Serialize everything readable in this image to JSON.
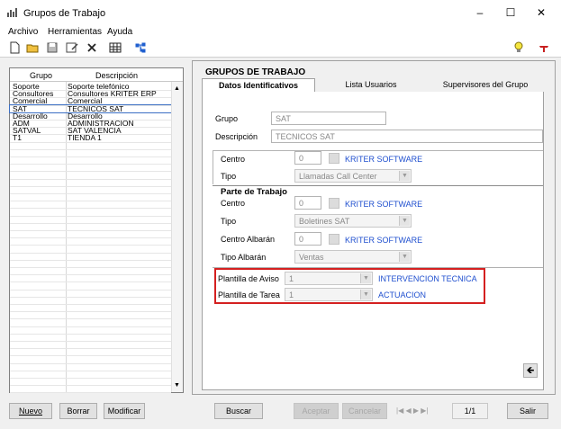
{
  "window": {
    "title": "Grupos de Trabajo",
    "minimize": "–",
    "maximize": "☐",
    "close": "✕"
  },
  "menu": [
    "Archivo",
    "Herramientas",
    "Ayuda"
  ],
  "toolbar": {
    "icons": [
      "new-icon",
      "open-icon",
      "save-icon",
      "edit-icon",
      "delete-icon",
      "grid-icon",
      "tree-icon",
      "lightbulb-icon",
      "exit-icon"
    ]
  },
  "list": {
    "headers": [
      "Grupo",
      "Descripción"
    ],
    "rows": [
      [
        "Soporte",
        "Soporte telefónico"
      ],
      [
        "Consultores",
        "Consultores KRITER ERP"
      ],
      [
        "Comercial",
        "Comercial"
      ],
      [
        "SAT",
        "TECNICOS SAT"
      ],
      [
        "Desarrollo",
        "Desarrollo"
      ],
      [
        "ADM",
        "ADMINISTRACION"
      ],
      [
        "SATVAL",
        "SAT VALENCIA"
      ],
      [
        "T1",
        "TIENDA 1"
      ]
    ],
    "selected_index": 3
  },
  "panel": {
    "title": "GRUPOS DE TRABAJO",
    "tabs": [
      "Datos Identificativos",
      "Lista Usuarios",
      "Supervisores del Grupo"
    ],
    "grupo_label": "Grupo",
    "grupo_value": "SAT",
    "descripcion_label": "Descripción",
    "descripcion_value": "TECNICOS SAT",
    "centro_label": "Centro",
    "centro_value": "0",
    "centro_name": "KRITER SOFTWARE",
    "tipo_label": "Tipo",
    "tipo_value": "Llamadas Call Center",
    "parte_title": "Parte de Trabajo",
    "parte_centro_label": "Centro",
    "parte_centro_value": "0",
    "parte_centro_name": "KRITER SOFTWARE",
    "parte_tipo_label": "Tipo",
    "parte_tipo_value": "Boletines SAT",
    "albaran_centro_label": "Centro Albarán",
    "albaran_centro_value": "0",
    "albaran_centro_name": "KRITER SOFTWARE",
    "albaran_tipo_label": "Tipo Albarán",
    "albaran_tipo_value": "Ventas",
    "plantilla_aviso_label": "Plantilla de Aviso",
    "plantilla_aviso_value": "1",
    "plantilla_aviso_name": "INTERVENCION TECNICA",
    "plantilla_tarea_label": "Plantilla de Tarea",
    "plantilla_tarea_value": "1",
    "plantilla_tarea_name": "ACTUACION",
    "back_arrow": "🡸"
  },
  "buttons": {
    "nuevo": "Nuevo",
    "borrar": "Borrar",
    "modificar": "Modificar",
    "buscar": "Buscar",
    "aceptar": "Aceptar",
    "cancelar": "Cancelar",
    "nav": "|◀ ◀ ▶ ▶|",
    "page": "1/1",
    "salir": "Salir"
  }
}
